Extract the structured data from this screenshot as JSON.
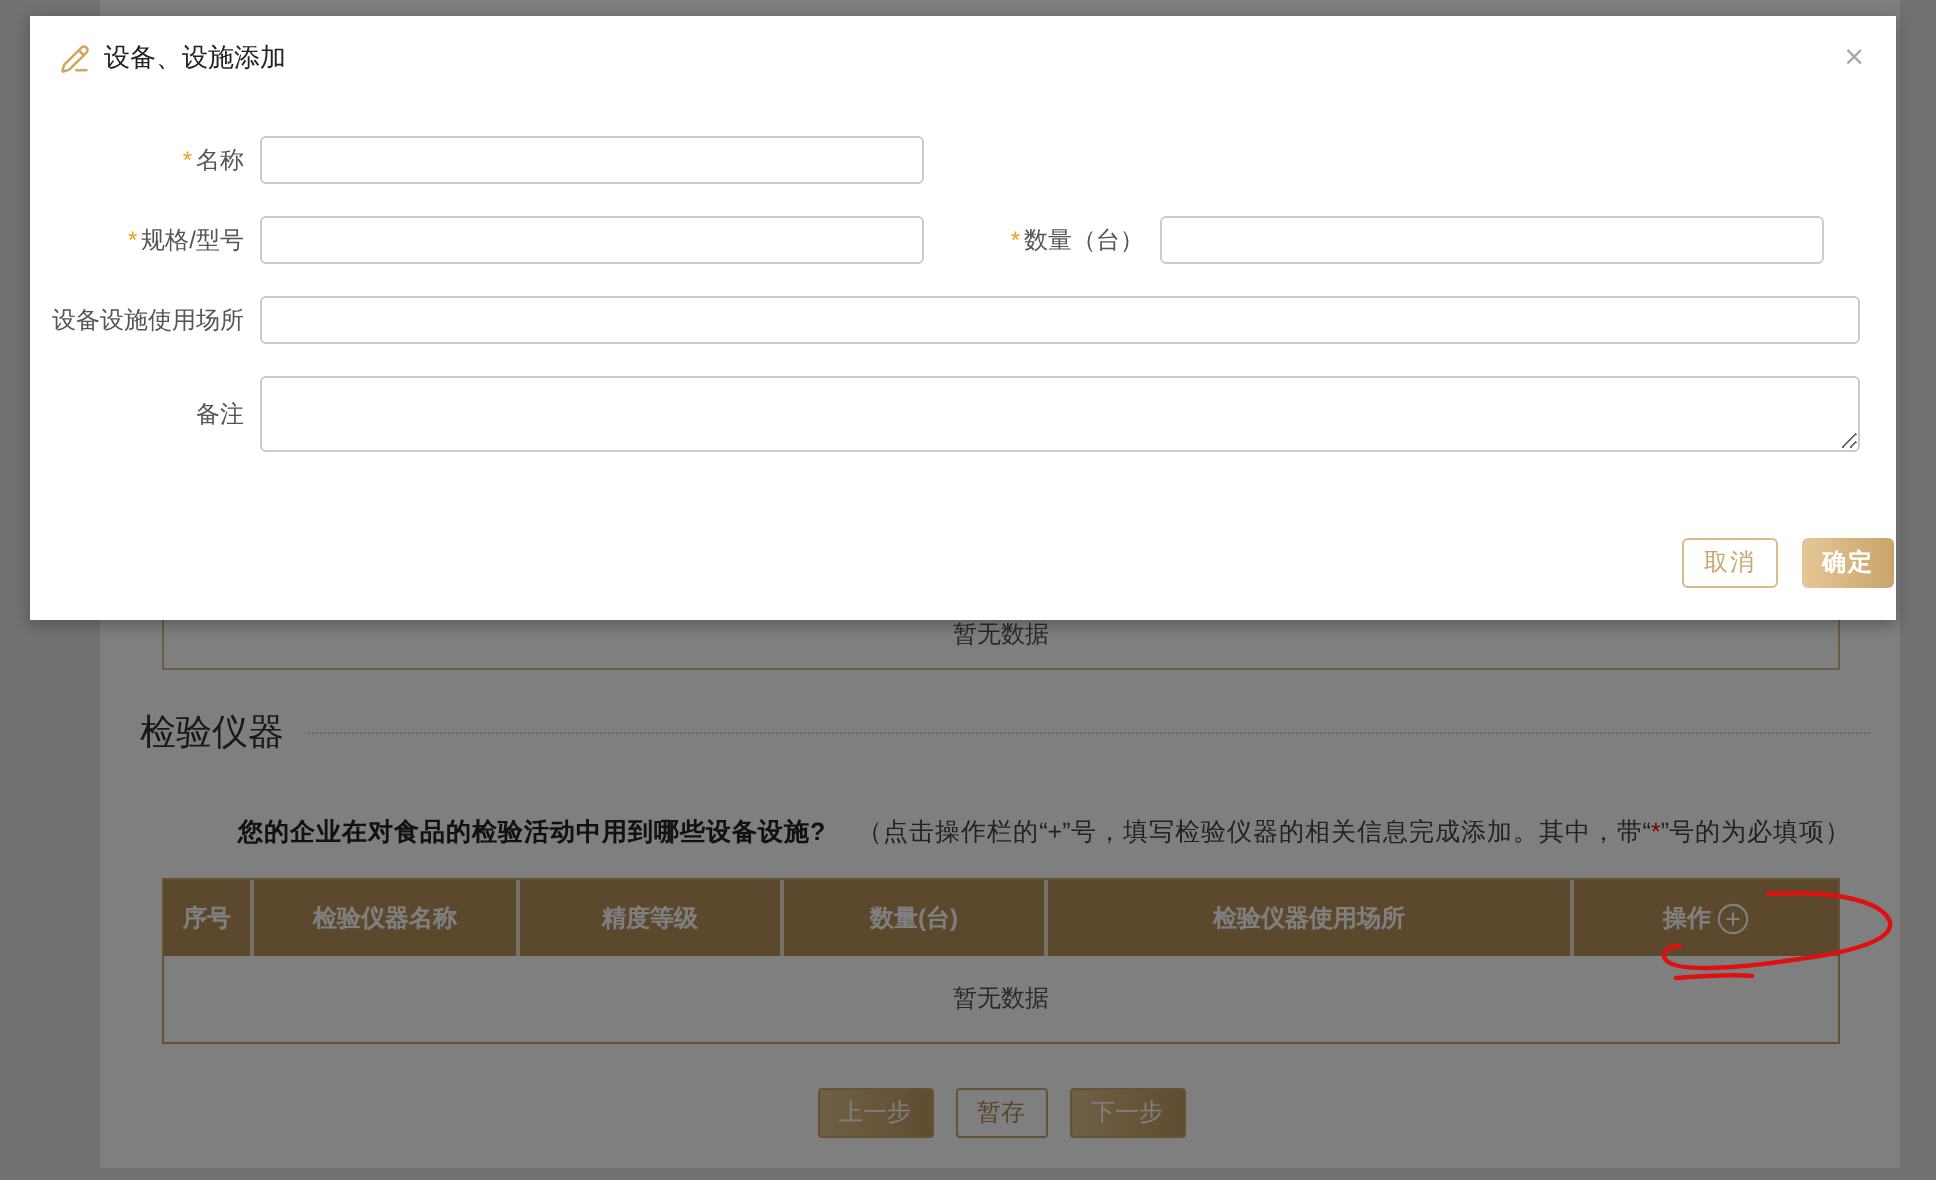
{
  "page": {
    "previous_table": {
      "empty_text": "暂无数据"
    },
    "section_title": "检验仪器",
    "note": {
      "question": "您的企业在对食品的检验活动中用到哪些设备设施?",
      "hint_before": "（点击操作栏的“+”号，填写检验仪器的相关信息完成添加。其中，带“",
      "hint_mark": "*",
      "hint_after": "”号的为必填项）"
    },
    "table": {
      "columns": [
        {
          "label": "序号"
        },
        {
          "label": "检验仪器名称"
        },
        {
          "label": "精度等级"
        },
        {
          "label": "数量(台)"
        },
        {
          "label": "检验仪器使用场所"
        },
        {
          "label": "操作",
          "kind": "add"
        }
      ],
      "empty_text": "暂无数据"
    },
    "buttons": [
      {
        "label": "上一步",
        "kind": "primary"
      },
      {
        "label": "暂存",
        "kind": "secondary"
      },
      {
        "label": "下一步",
        "kind": "primary"
      }
    ]
  },
  "dialog": {
    "title": "设备、设施添加",
    "close": "×",
    "rows": [
      [
        {
          "label": "名称",
          "required_mark": "*"
        }
      ],
      [
        {
          "label": "规格/型号",
          "required_mark": "*"
        },
        {
          "label": "数量（台）",
          "required_mark": "*"
        }
      ],
      [
        {
          "label": "设备设施使用场所"
        }
      ],
      [
        {
          "label": "备注",
          "kind": "textarea"
        }
      ]
    ],
    "buttons": [
      {
        "label": "取消",
        "kind": "secondary"
      },
      {
        "label": "确定",
        "kind": "primary"
      }
    ]
  }
}
